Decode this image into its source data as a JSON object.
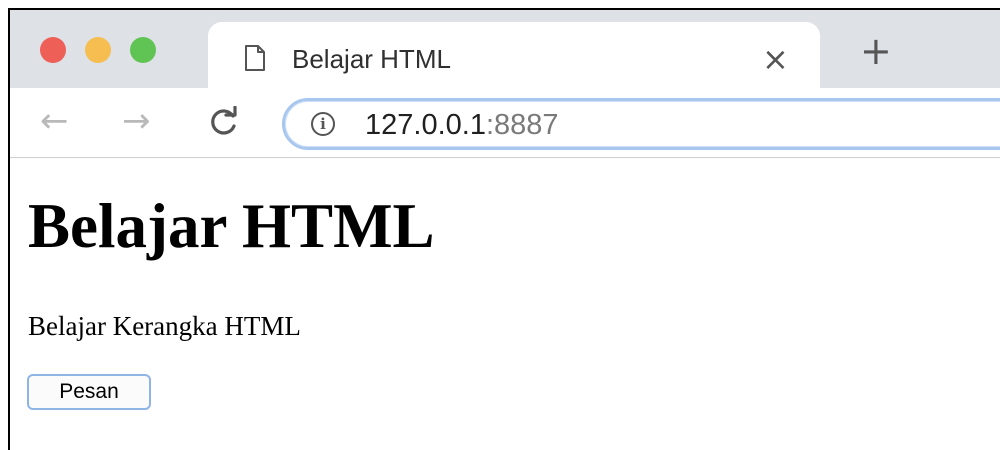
{
  "window": {
    "controls": [
      "close",
      "minimize",
      "maximize"
    ]
  },
  "tab": {
    "title": "Belajar HTML",
    "close_glyph": "×",
    "icon": "document-icon"
  },
  "new_tab": {
    "glyph": "+"
  },
  "toolbar": {
    "back_glyph": "←",
    "forward_glyph": "→",
    "reload_glyph": "C",
    "info_glyph": "i",
    "url_host": "127.0.0.1",
    "url_port": ":8887"
  },
  "page": {
    "heading": "Belajar HTML",
    "paragraph": "Belajar Kerangka HTML",
    "button_label": "Pesan"
  },
  "colors": {
    "close": "#ee5f58",
    "minimize": "#f6be50",
    "maximize": "#5fc454",
    "focus_ring": "#a8c7ef"
  }
}
